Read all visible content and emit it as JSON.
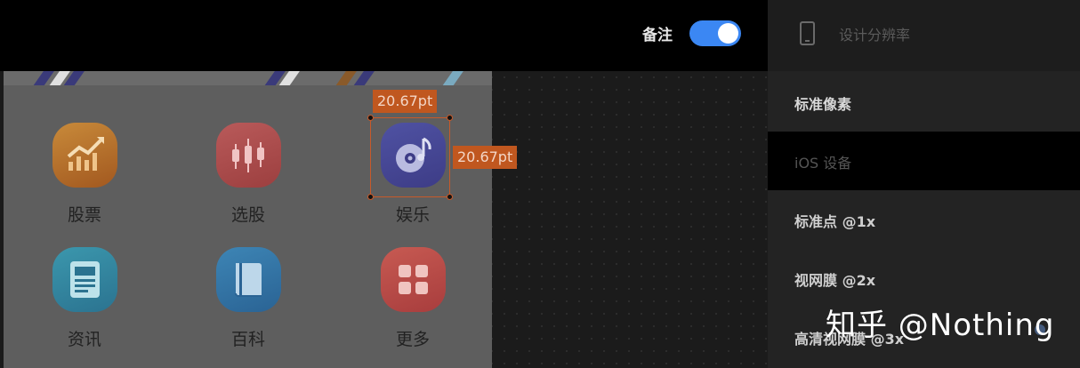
{
  "topbar": {
    "note_label": "备注",
    "note_toggle_on": true,
    "accent": "#3b87f3"
  },
  "apps": [
    {
      "label": "股票",
      "icon": "stock-chart-icon"
    },
    {
      "label": "选股",
      "icon": "candlestick-icon"
    },
    {
      "label": "娱乐",
      "icon": "music-disc-icon"
    },
    {
      "label": "资讯",
      "icon": "news-icon"
    },
    {
      "label": "百科",
      "icon": "book-icon"
    },
    {
      "label": "更多",
      "icon": "grid-icon"
    }
  ],
  "measure": {
    "width": "20.67pt",
    "height": "20.67pt",
    "color": "#c0571f"
  },
  "panel": {
    "title": "设计分辨率",
    "options": [
      {
        "label": "标准像素"
      },
      {
        "label": "iOS 设备"
      },
      {
        "label": "标准点 @1x"
      },
      {
        "label": "视网膜 @2x"
      },
      {
        "label": "高清视网膜 @3x"
      }
    ],
    "selected": "iOS 设备"
  },
  "watermark": "知乎 @Nothing"
}
